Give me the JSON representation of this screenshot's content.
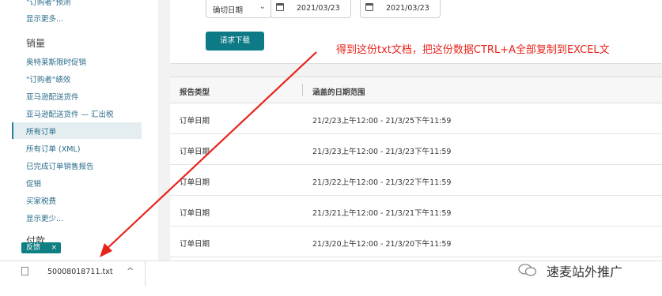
{
  "sidebar": {
    "items_top": [
      {
        "label": "\"订购者\"预测"
      },
      {
        "label": "显示更多..."
      }
    ],
    "sales_heading": "销量",
    "sales_items": [
      {
        "label": "奥特莱斯限时促销"
      },
      {
        "label": "\"订购者\"绩效"
      },
      {
        "label": "亚马逊配送货件"
      },
      {
        "label": "亚马逊配送货件 — 汇出税"
      },
      {
        "label": "所有订单"
      },
      {
        "label": "所有订单 (XML)"
      },
      {
        "label": "已完成订单销售报告"
      },
      {
        "label": "促销"
      },
      {
        "label": "买家税费"
      },
      {
        "label": "显示更少..."
      }
    ],
    "active_item": "所有订单",
    "payments_heading": "付款",
    "feedback_label": "反馈",
    "feedback_close": "×"
  },
  "form": {
    "date_type_value": "确切日期",
    "start_date": "2021/03/23",
    "end_date": "2021/03/23",
    "request_button": "请求下载"
  },
  "table": {
    "headers": {
      "type": "报告类型",
      "range": "涵盖的日期范围"
    },
    "rows": [
      {
        "type": "订单日期",
        "range": "21/2/23上午12:00 - 21/3/25下午11:59"
      },
      {
        "type": "订单日期",
        "range": "21/3/23上午12:00 - 21/3/23下午11:59"
      },
      {
        "type": "订单日期",
        "range": "21/3/22上午12:00 - 21/3/22下午11:59"
      },
      {
        "type": "订单日期",
        "range": "21/3/21上午12:00 - 21/3/21下午11:59"
      },
      {
        "type": "订单日期",
        "range": "21/3/20上午12:00 - 21/3/20下午11:59"
      }
    ]
  },
  "annotation": {
    "text": "得到这份txt文档，把这份数据CTRL+A全部复制到EXCEL文",
    "color": "#e8231a"
  },
  "download_bar": {
    "file_name": "50008018711.txt",
    "chevron": "^"
  },
  "watermark": {
    "text": "速麦站外推广"
  },
  "colors": {
    "accent": "#0e7a86",
    "link": "#2a6b8a"
  }
}
